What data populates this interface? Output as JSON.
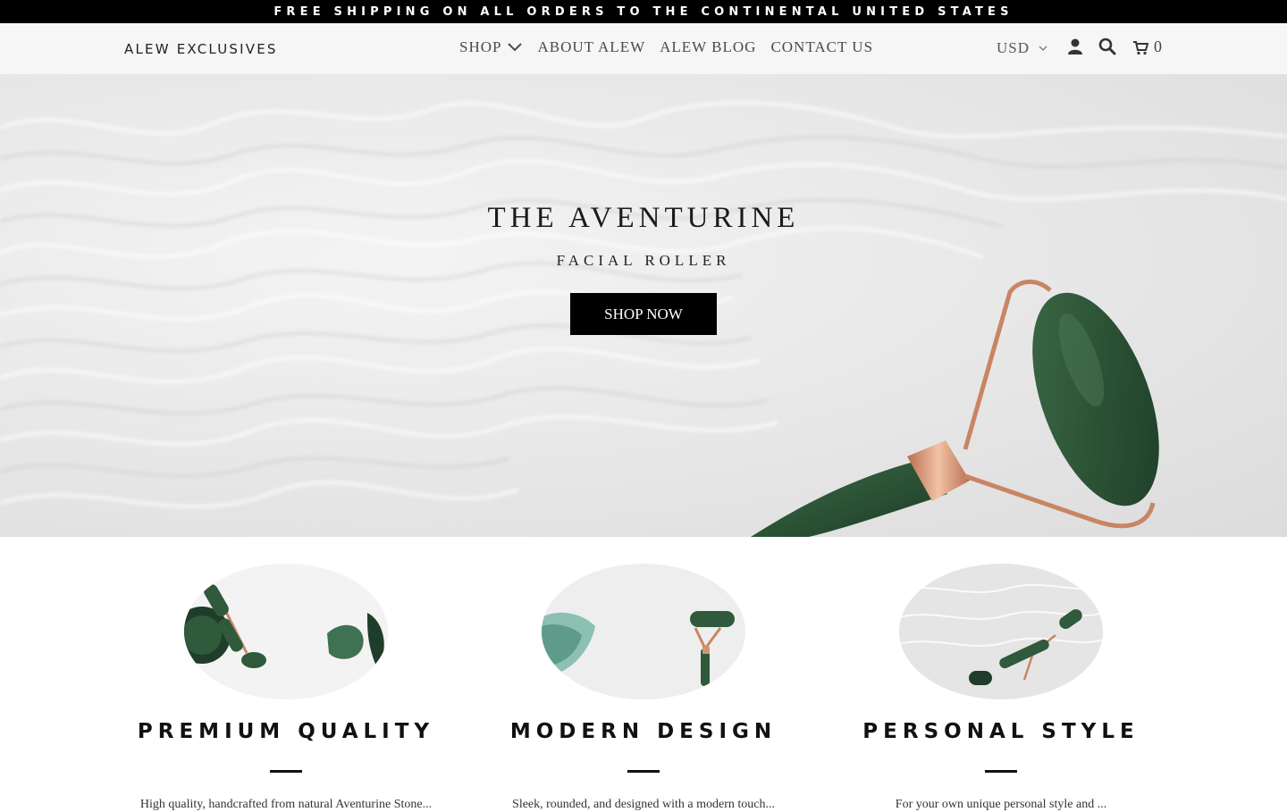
{
  "announcement": "FREE SHIPPING ON ALL ORDERS TO THE CONTINENTAL UNITED STATES",
  "header": {
    "logo": "ALEW EXCLUSIVES",
    "nav": [
      {
        "label": "SHOP"
      },
      {
        "label": "ABOUT ALEW"
      },
      {
        "label": "ALEW BLOG"
      },
      {
        "label": "CONTACT US"
      }
    ],
    "currency": "USD",
    "cart_count": "0"
  },
  "hero": {
    "title": "THE AVENTURINE",
    "subtitle": "FACIAL ROLLER",
    "button_label": "SHOP NOW"
  },
  "features": [
    {
      "title": "PREMIUM QUALITY",
      "desc": "High quality, handcrafted from natural Aventurine Stone..."
    },
    {
      "title": "MODERN DESIGN",
      "desc": "Sleek, rounded, and designed with a modern touch..."
    },
    {
      "title": "PERSONAL STYLE",
      "desc": "For your own unique personal style and ..."
    }
  ],
  "colors": {
    "accent": "#000000",
    "stone": "#2f5a3b",
    "rose_gold": "#d49472"
  }
}
